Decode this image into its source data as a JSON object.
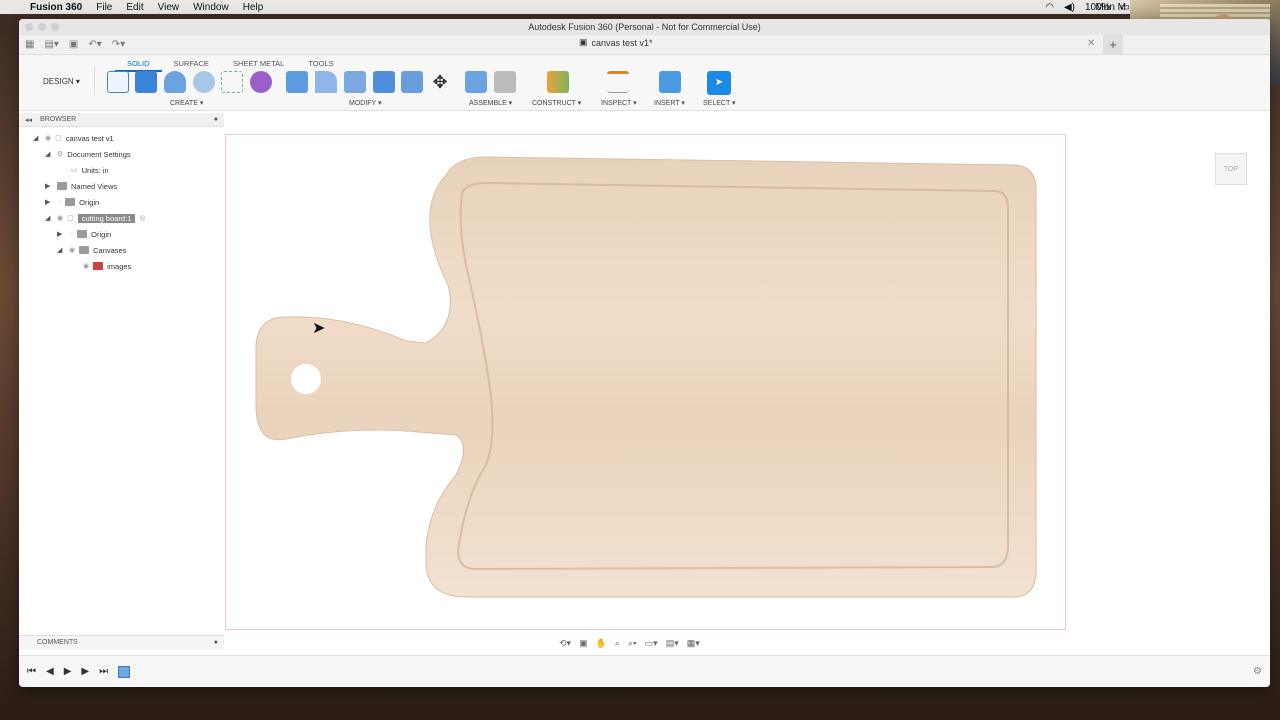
{
  "menubar": {
    "apple": "",
    "app_name": "Fusion 360",
    "menus": [
      "File",
      "Edit",
      "View",
      "Window",
      "Help"
    ],
    "battery": "100%",
    "clock": "Mon M"
  },
  "window": {
    "title": "Autodesk Fusion 360 (Personal - Not for Commercial Use)",
    "doc_tab": "canvas test v1*"
  },
  "ribbon": {
    "workspace": "DESIGN ▾",
    "tabs": [
      "SOLID",
      "SURFACE",
      "SHEET METAL",
      "TOOLS"
    ],
    "groups": [
      "CREATE ▾",
      "MODIFY ▾",
      "ASSEMBLE ▾",
      "CONSTRUCT ▾",
      "INSPECT ▾",
      "INSERT ▾",
      "SELECT ▾"
    ]
  },
  "browser": {
    "header": "BROWSER",
    "items": [
      {
        "label": "canvas test v1"
      },
      {
        "label": "Document Settings"
      },
      {
        "label": "Units: in"
      },
      {
        "label": "Named Views"
      },
      {
        "label": "Origin"
      },
      {
        "label": "cutting board:1"
      },
      {
        "label": "Origin"
      },
      {
        "label": "Canvases"
      },
      {
        "label": "images"
      }
    ]
  },
  "comments": {
    "label": "COMMENTS"
  },
  "viewcube": {
    "label": "TOP"
  }
}
